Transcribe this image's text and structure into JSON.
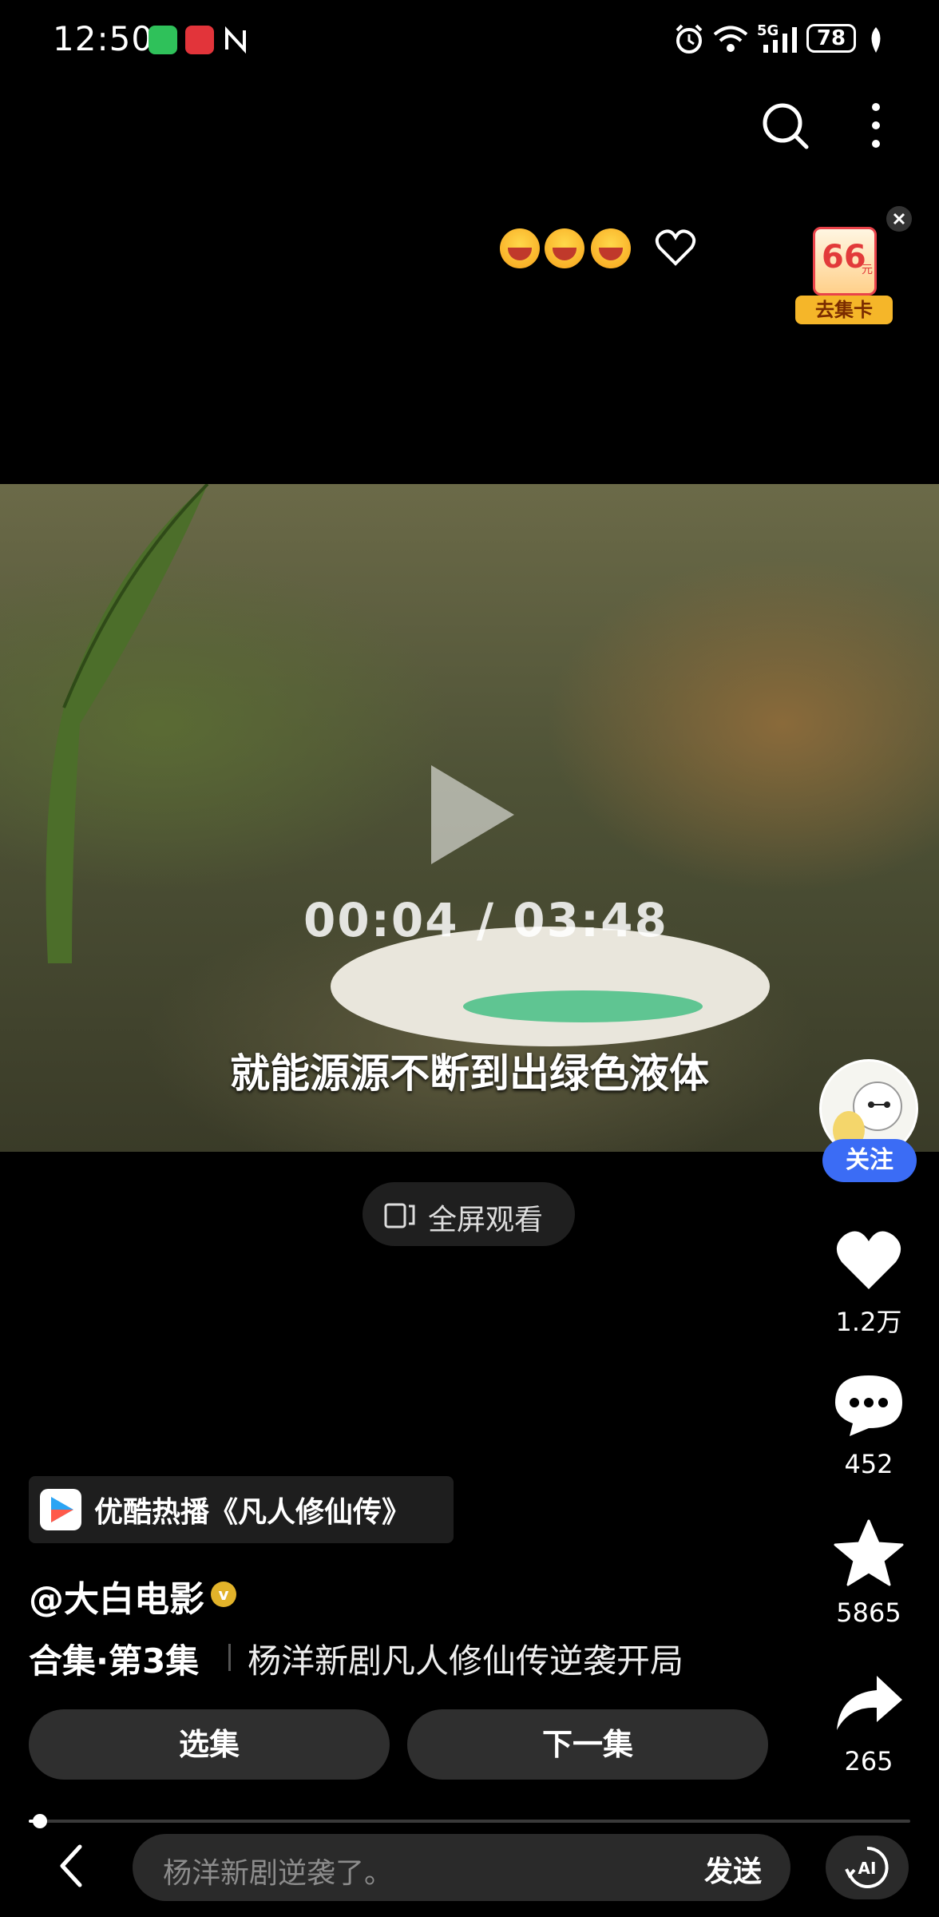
{
  "status_bar": {
    "time": "12:50",
    "network": "5G",
    "battery": "78"
  },
  "top_actions": {
    "search_icon": "search-icon",
    "more_icon": "more-vertical-icon"
  },
  "promo": {
    "amount": "66",
    "unit": "元",
    "label": "去集卡"
  },
  "video": {
    "current_time": "00:04",
    "separator": "/",
    "total_time": "03:48",
    "subtitle": "就能源源不断到出绿色液体",
    "progress": 0.013
  },
  "fullscreen": {
    "label": "全屏观看"
  },
  "rail": {
    "follow_label": "关注",
    "likes": "1.2万",
    "comments": "452",
    "favorites": "5865",
    "shares": "265"
  },
  "series": {
    "title": "优酷热播《凡人修仙传》"
  },
  "author": {
    "name": "@大白电影"
  },
  "collection": {
    "label": "合集·第3集",
    "description": "杨洋新剧凡人修仙传逆袭开局"
  },
  "episode_buttons": {
    "select": "选集",
    "next": "下一集"
  },
  "comment_bar": {
    "placeholder": "杨洋新剧逆袭了。",
    "send": "发送",
    "ai": "AI"
  },
  "colors": {
    "follow_blue": "#3b6cf5",
    "verified_gold": "#e2b32a",
    "promo_orange": "#f5b629"
  }
}
